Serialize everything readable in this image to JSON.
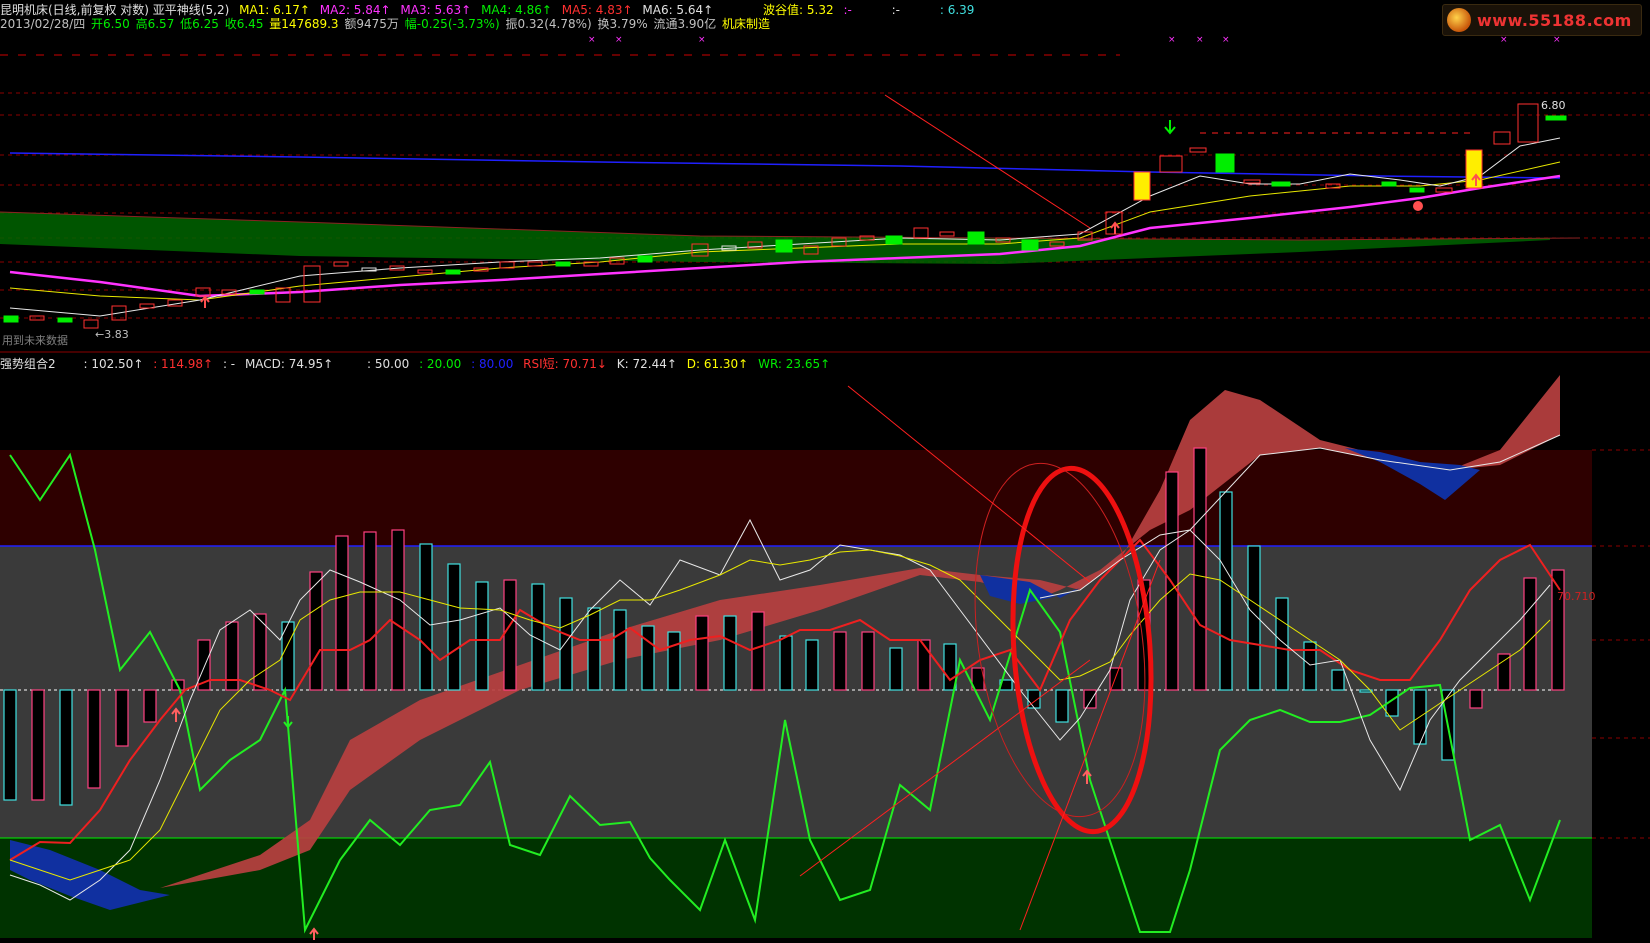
{
  "header": {
    "title": "昆明机床(日线,前复权 对数) 亚平神线(5,2)",
    "ma1": "MA1: 6.17↑",
    "ma2": "MA2: 5.84↑",
    "ma3": "MA3: 5.63↑",
    "ma4": "MA4: 4.86↑",
    "ma5": "MA5: 4.83↑",
    "ma6": "MA6: 5.64↑",
    "wave": "波谷值: 5.32",
    "dash1": ":-",
    "dash2": ":-",
    "val": ": 6.39"
  },
  "stats": {
    "date": "2013/02/28/四",
    "open": "开6.50",
    "high": "高6.57",
    "low": "低6.25",
    "close": "收6.45",
    "volume": "量147689.3",
    "amount": "额9475万",
    "change": "幅-0.25(-3.73%)",
    "amplitude": "振0.32(4.78%)",
    "turnover": "换3.79%",
    "float": "流通3.90亿",
    "industry": "机床制造"
  },
  "logo": {
    "text": "www.55188.com"
  },
  "price_pane": {
    "note": "用到未来数据",
    "low_label": "←3.83",
    "high_label": "6.80"
  },
  "indicator": {
    "name": "强势组合2",
    "v1": ": 102.50↑",
    "v2": ": 114.98↑",
    "v3": ": -",
    "macd": "MACD: 74.95↑",
    "v4": ": 50.00",
    "v5": ": 20.00",
    "v6": ": 80.00",
    "rsi": "RSI短: 70.71↓",
    "k": "K: 72.44↑",
    "d": "D: 61.30↑",
    "wr": "WR: 23.65↑",
    "end_label": "70.710"
  },
  "colors": {
    "ma_white": "#e8e8e8",
    "ma_yellow": "#e8e800",
    "ma_magenta": "#ff33ff",
    "ma_blue": "#2020ff",
    "ma_green_band": "#006400",
    "up": "#ff3030",
    "down": "#00ee00",
    "cyan": "#40e0e0",
    "label_yellow": "#ffff00"
  }
}
